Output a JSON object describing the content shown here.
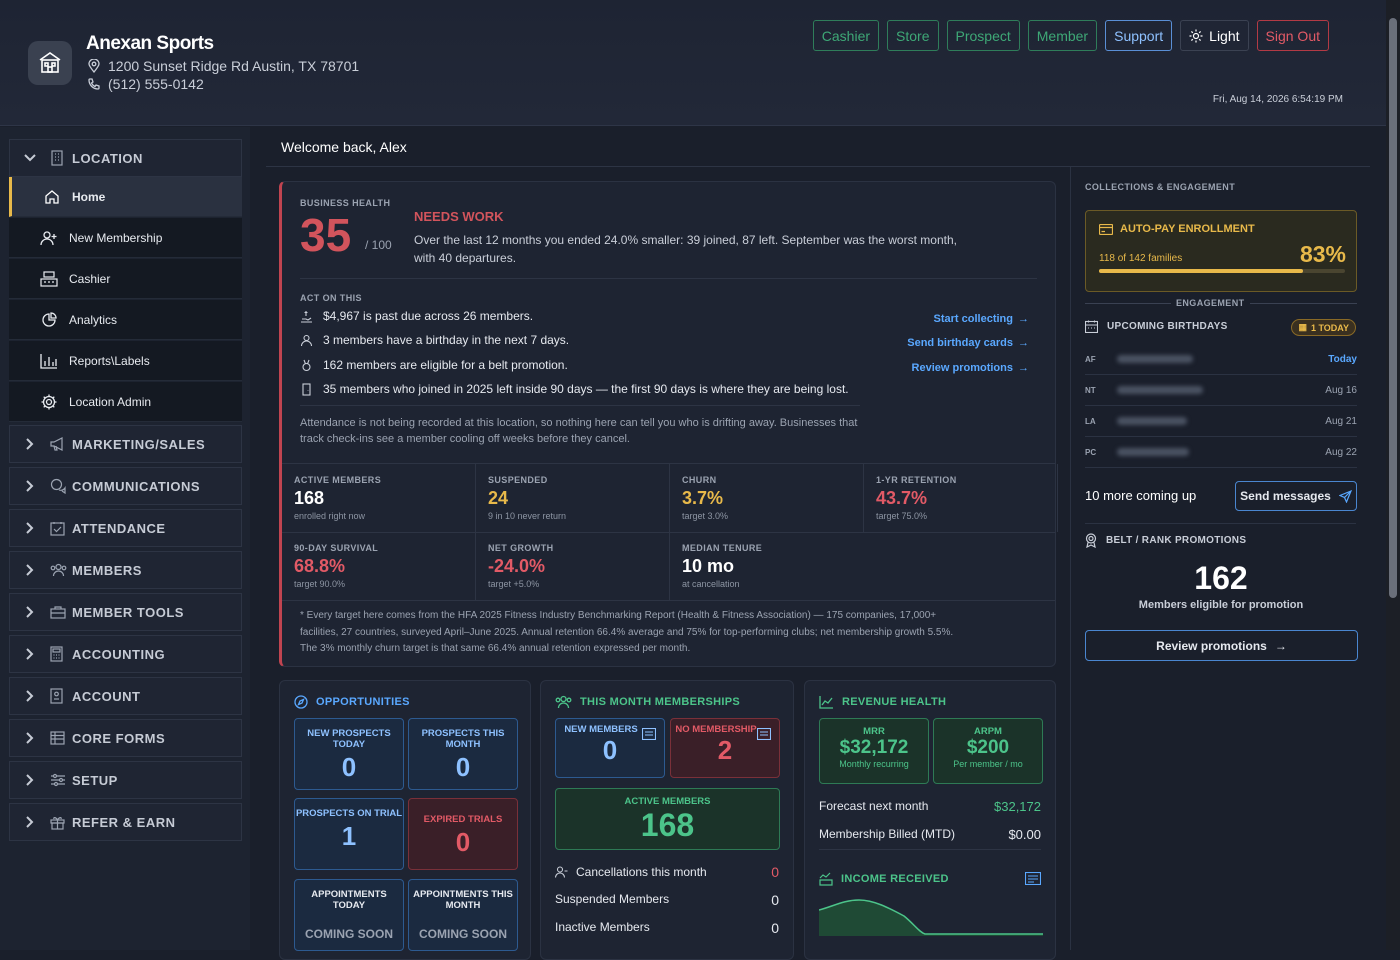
{
  "header": {
    "business_name": "Anexan Sports",
    "address": "1200 Sunset Ridge Rd  Austin, TX 78701",
    "phone": "(512) 555-0142",
    "buttons": {
      "cashier": "Cashier",
      "store": "Store",
      "prospect": "Prospect",
      "member": "Member",
      "support": "Support",
      "light": "Light",
      "signout": "Sign Out"
    },
    "datetime": "Fri, Aug 14, 2026 6:54:19 PM"
  },
  "sidebar": {
    "location_group": "LOCATION",
    "items": [
      {
        "label": "Home",
        "icon": "home-icon"
      },
      {
        "label": "New Membership",
        "icon": "user-plus-icon"
      },
      {
        "label": "Cashier",
        "icon": "register-icon"
      },
      {
        "label": "Analytics",
        "icon": "pie-chart-icon"
      },
      {
        "label": "Reports\\Labels",
        "icon": "bar-chart-icon"
      },
      {
        "label": "Location Admin",
        "icon": "gear-icon"
      }
    ],
    "groups": [
      "MARKETING/SALES",
      "COMMUNICATIONS",
      "ATTENDANCE",
      "MEMBERS",
      "MEMBER TOOLS",
      "ACCOUNTING",
      "ACCOUNT",
      "CORE FORMS",
      "SETUP",
      "REFER & EARN"
    ]
  },
  "welcome": "Welcome back, Alex",
  "health": {
    "label": "BUSINESS HEALTH",
    "score": "35",
    "score_of": "/ 100",
    "status": "NEEDS WORK",
    "description": "Over the last 12 months you ended 24.0% smaller: 39 joined, 87 left. September was the worst month, with 40 departures.",
    "act_label": "ACT ON THIS",
    "actions": [
      "$4,967 is past due across 26 members.",
      "3 members have a birthday in the next 7 days.",
      "162 members are eligible for a belt promotion.",
      "35 members who joined in 2025 left inside 90 days — the first 90 days is where they are being lost."
    ],
    "links": [
      "Start collecting",
      "Send birthday cards",
      "Review promotions"
    ],
    "attendance_note": "Attendance is not being recorded at this location, so nothing here can tell you who is drifting away. Businesses that track check-ins see a member cooling off weeks before they cancel.",
    "metrics": [
      {
        "label": "ACTIVE MEMBERS",
        "value": "168",
        "sub": "enrolled right now",
        "color": "#ffffff"
      },
      {
        "label": "SUSPENDED",
        "value": "24",
        "sub": "9 in 10 never return",
        "color": "#e8b94a"
      },
      {
        "label": "CHURN",
        "value": "3.7%",
        "sub": "target 3.0%",
        "color": "#e8b94a"
      },
      {
        "label": "1-YR RETENTION",
        "value": "43.7%",
        "sub": "target 75.0%",
        "color": "#e25a66"
      },
      {
        "label": "90-DAY SURVIVAL",
        "value": "68.8%",
        "sub": "target 90.0%",
        "color": "#e25a66"
      },
      {
        "label": "NET GROWTH",
        "value": "-24.0%",
        "sub": "target +5.0%",
        "color": "#e25a66"
      },
      {
        "label": "MEDIAN TENURE",
        "value": "10 mo",
        "sub": "at cancellation",
        "color": "#ffffff"
      }
    ],
    "footnote": "* Every target here comes from the HFA 2025 Fitness Industry Benchmarking Report (Health & Fitness Association) — 175 companies, 17,000+ facilities, 27 countries, surveyed April–June 2025. Annual retention 66.4% average and 75% for top-performing clubs; net membership growth 5.5%. The 3% monthly churn target is that same 66.4% annual retention expressed per month."
  },
  "opportunities": {
    "title": "OPPORTUNITIES",
    "tiles": [
      {
        "label": "NEW PROSPECTS TODAY",
        "value": "0"
      },
      {
        "label": "PROSPECTS THIS MONTH",
        "value": "0"
      },
      {
        "label": "PROSPECTS ON TRIAL",
        "value": "1"
      },
      {
        "label": "EXPIRED TRIALS",
        "value": "0"
      },
      {
        "label": "APPOINTMENTS TODAY",
        "value": "COMING SOON"
      },
      {
        "label": "APPOINTMENTS THIS MONTH",
        "value": "COMING SOON"
      }
    ]
  },
  "memberships": {
    "title": "THIS MONTH MEMBERSHIPS",
    "new_members_label": "NEW MEMBERS",
    "new_members": "0",
    "no_membership_label": "NO MEMBERSHIP",
    "no_membership": "2",
    "active_label": "ACTIVE MEMBERS",
    "active": "168",
    "rows": [
      {
        "label": "Cancellations this month",
        "value": "0"
      },
      {
        "label": "Suspended Members",
        "value": "0"
      },
      {
        "label": "Inactive Members",
        "value": "0"
      }
    ]
  },
  "revenue": {
    "title": "REVENUE HEALTH",
    "mrr_label": "MRR",
    "mrr": "$32,172",
    "mrr_sub": "Monthly recurring",
    "arpm_label": "ARPM",
    "arpm": "$200",
    "arpm_sub": "Per member / mo",
    "forecast_label": "Forecast next month",
    "forecast": "$32,172",
    "billed_label": "Membership Billed (MTD)",
    "billed": "$0.00",
    "income_title": "INCOME RECEIVED"
  },
  "collections": {
    "title": "COLLECTIONS & ENGAGEMENT",
    "autopay_title": "AUTO-PAY ENROLLMENT",
    "autopay_sub": "118 of 142 families",
    "autopay_pct": "83%",
    "autopay_fraction": 0.83,
    "engagement_label": "ENGAGEMENT",
    "birthdays_title": "UPCOMING BIRTHDAYS",
    "today_badge": "1 TODAY",
    "birthdays": [
      {
        "initials": "AF",
        "date": "Today"
      },
      {
        "initials": "NT",
        "date": "Aug 16"
      },
      {
        "initials": "LA",
        "date": "Aug 21"
      },
      {
        "initials": "PC",
        "date": "Aug 22"
      }
    ],
    "more_coming": "10 more coming up",
    "send_messages": "Send messages",
    "belt_title": "BELT / RANK PROMOTIONS",
    "belt_count": "162",
    "belt_sub": "Members eligible for promotion",
    "review_button": "Review promotions"
  }
}
